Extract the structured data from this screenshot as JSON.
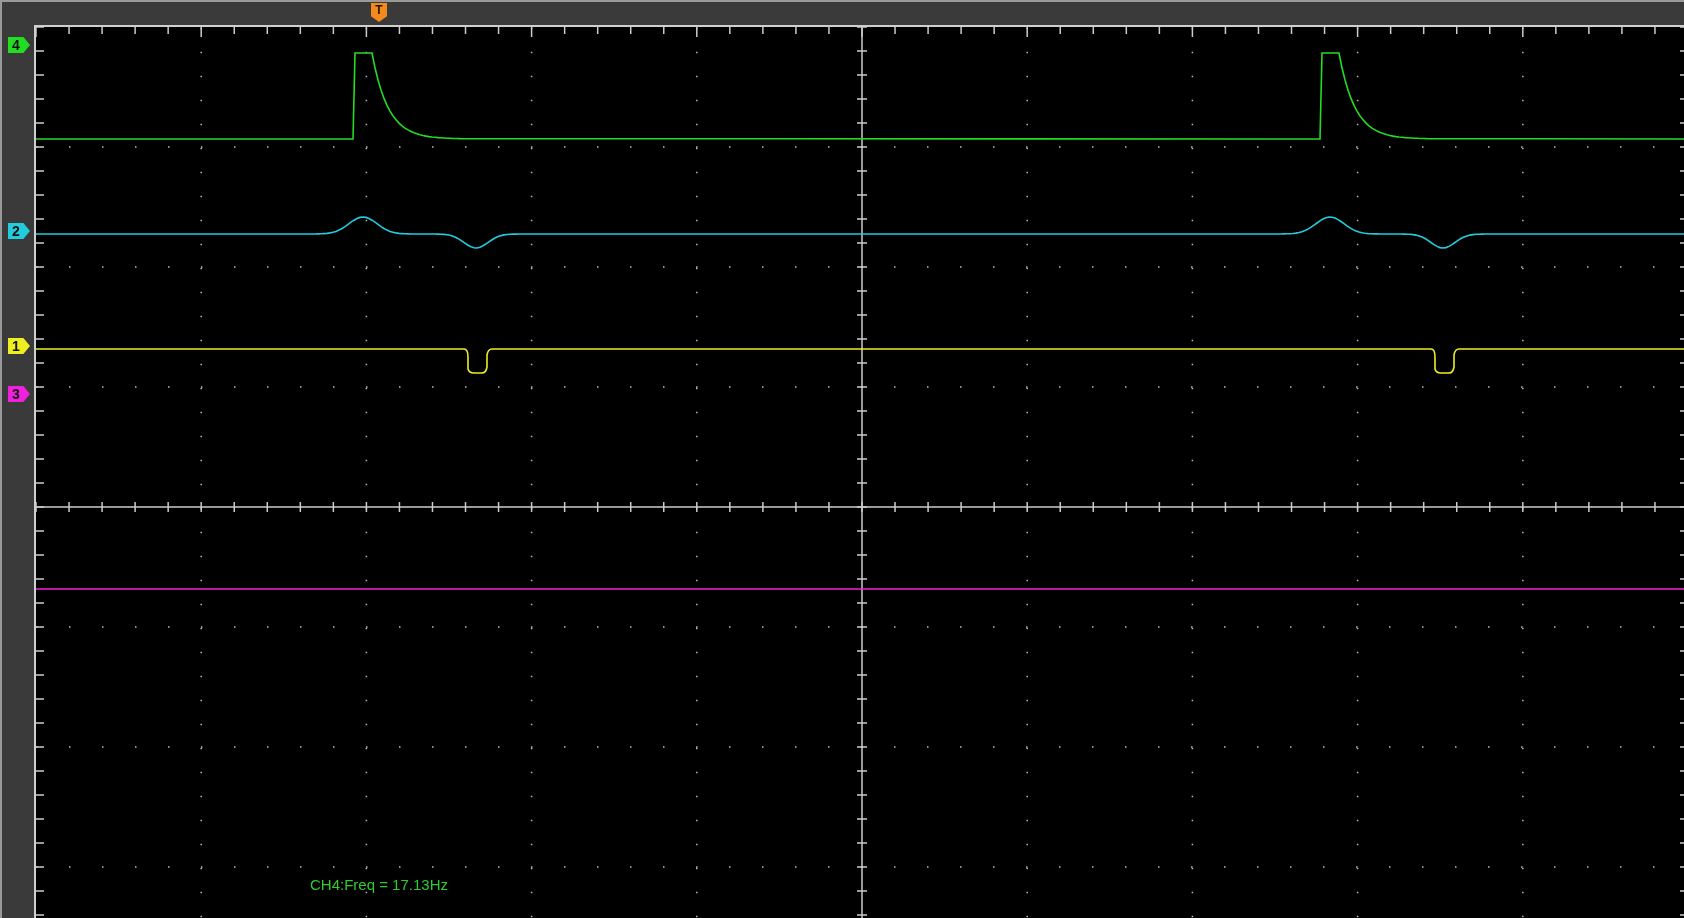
{
  "trigger_marker": {
    "label": "T",
    "color": "#f28a1e"
  },
  "channels": [
    {
      "label": "4",
      "color": "#22dd22",
      "kind": "pulse"
    },
    {
      "label": "2",
      "color": "#22ccdd",
      "kind": "bump"
    },
    {
      "label": "1",
      "color": "#eeee22",
      "kind": "dip"
    },
    {
      "label": "3",
      "color": "#ee22dd",
      "kind": "flat"
    }
  ],
  "measurement": "CH4:Freq = 17.13Hz"
}
